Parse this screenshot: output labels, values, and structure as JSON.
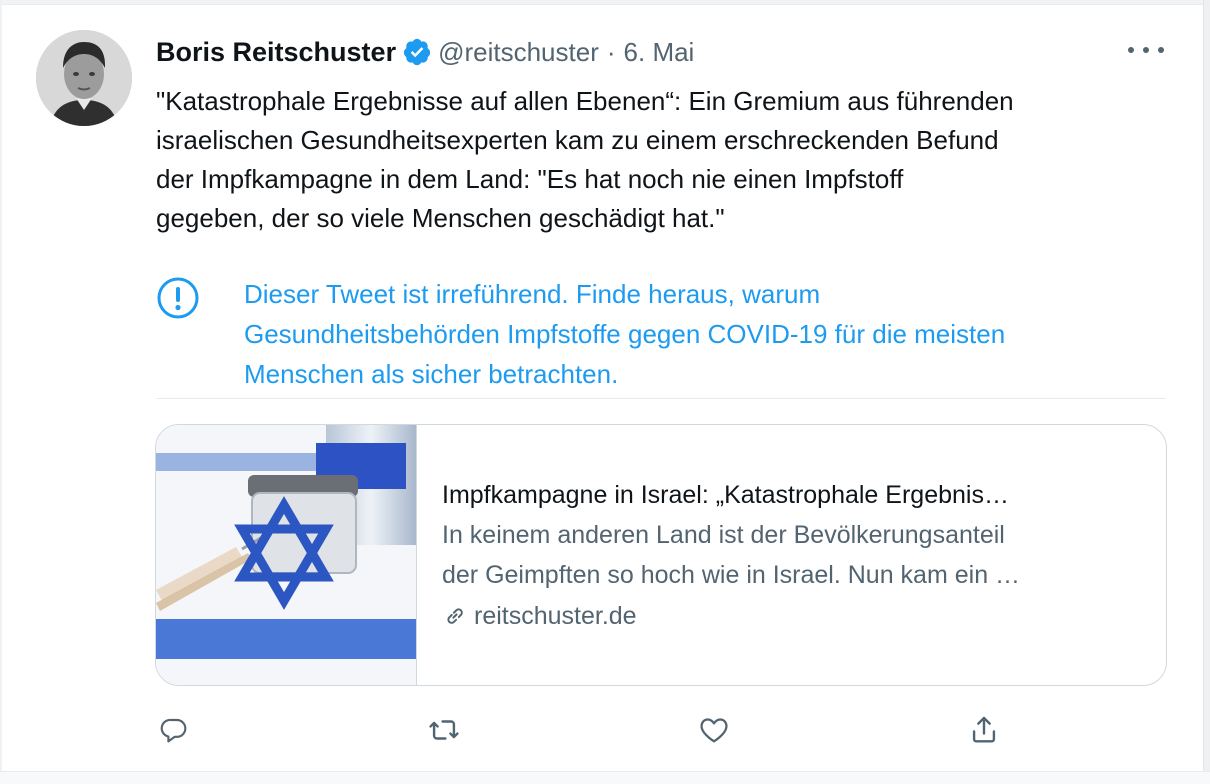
{
  "tweet": {
    "author_name": "Boris Reitschuster",
    "handle": "@reitschuster",
    "separator": "·",
    "date": "6. Mai",
    "text_lines": [
      "\"Katastrophale Ergebnisse auf allen Ebenen“: Ein Gremium aus führenden",
      "israelischen Gesundheitsexperten kam zu einem erschreckenden Befund",
      "der Impfkampagne in dem Land: \"Es hat noch nie einen Impfstoff",
      "gegeben, der so viele Menschen geschädigt hat.\""
    ],
    "verified": true
  },
  "warning": {
    "lines": [
      "Dieser Tweet ist irreführend. Finde heraus, warum",
      "Gesundheitsbehörden Impfstoffe gegen COVID-19 für die meisten",
      "Menschen als sicher betrachten."
    ],
    "icon": "exclamation-circle-icon"
  },
  "link_card": {
    "title": "Impfkampagne in Israel: „Katastrophale Ergebnis…",
    "description_lines": [
      "In keinem anderen Land ist der Bevölkerungsanteil",
      "der Geimpften so hoch wie in Israel. Nun kam ein …"
    ],
    "domain": "reitschuster.de",
    "link_icon": "link-icon"
  },
  "actions": [
    {
      "name": "reply",
      "icon": "reply-icon"
    },
    {
      "name": "retweet",
      "icon": "retweet-icon"
    },
    {
      "name": "like",
      "icon": "heart-icon"
    },
    {
      "name": "share",
      "icon": "share-icon"
    }
  ],
  "colors": {
    "accent": "#1d9bf0",
    "verified": "#1d9bf0",
    "secondary_text": "#536471",
    "primary_text": "#0f1419"
  }
}
